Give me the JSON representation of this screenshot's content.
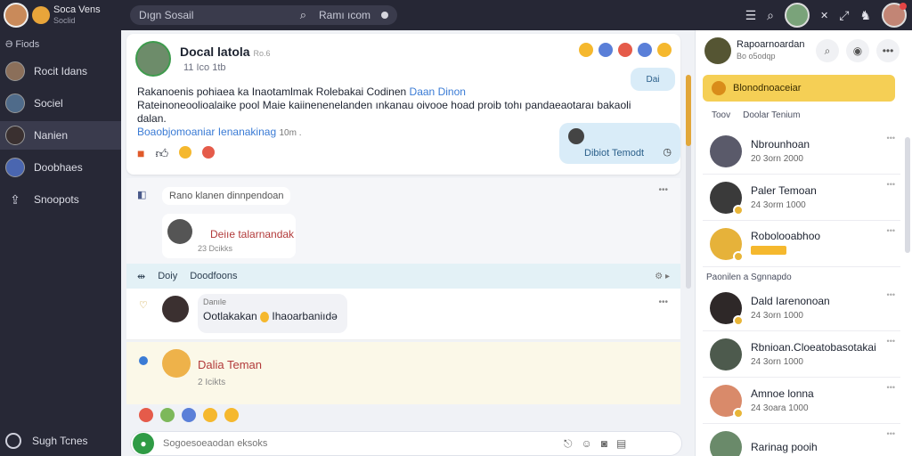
{
  "brand": {
    "name": "Soca Vens",
    "sub": "Soclid"
  },
  "search": {
    "placeholder": "Dıgn Sosail",
    "scope": "Ramı ıcom"
  },
  "sidebar": {
    "header": "Ə Fiods",
    "items": [
      {
        "label": "Rocit Idans"
      },
      {
        "label": "Sociel"
      },
      {
        "label": "Nanien"
      },
      {
        "label": "Doobhaes"
      },
      {
        "label": "Snoopots"
      }
    ],
    "bottom": "Sugh Tcnes"
  },
  "post": {
    "author": "Docal latola",
    "author_suffix": "Ro.6",
    "meta": "11 Ico 1tb",
    "body_line1": "Rakanoenis pohiaea ka Inaotamlmak Rolebakai Codinen",
    "body_link1": "Daan Dinon",
    "body_line2": "Rateinoneoolioalaike pool Maie kaiinenenelanden ınkanau oivooe hoad proib tohı pandaeaotaraı",
    "body_line2_tail": "bakaoli dalan.",
    "body_line3_link": "Boaobjomoaniar Ienanakinag",
    "body_line3_meta": "10m .",
    "bubble_top": "Dai",
    "bubble_name": "Dibiot Temodt"
  },
  "comments": {
    "header": "Rano klanen dinnpendoan",
    "first_name": "Deiıe talarnandak",
    "first_meta": "23 Dcikks"
  },
  "tabs": {
    "a": "Doiy",
    "b": "Doodfoons"
  },
  "reply1": {
    "author": "Danıle",
    "text": "Ootlakakan",
    "tail": "Ihaoarbaniıdə"
  },
  "reply2": {
    "name": "Dalia Teman",
    "meta": "2 Icikts"
  },
  "composer": {
    "placeholder": "Sogoesoeaodan eksoks"
  },
  "right": {
    "head_title": "Rapoarnoardan",
    "head_sub": "Bo o5odqp",
    "banner": "Blonodnoaceiar",
    "subhead_a": "Toov",
    "subhead_b": "Doolar Tenium",
    "contacts": [
      {
        "name": "Nbrounhoan",
        "meta": "20 3orn 2000"
      },
      {
        "name": "Paler Temoan",
        "meta": "24 3orm 1000"
      },
      {
        "name": "Robolooabhoo",
        "meta": ""
      },
      {
        "name": "Dald Iarenonoan",
        "meta": "24 3orn 1000"
      },
      {
        "name": "Rbnioan.Cloeatobasotakai",
        "meta": "24 3orn 1000"
      },
      {
        "name": "Amnoe lonna",
        "meta": "24 3oara 1000"
      },
      {
        "name": "Rarinag pooih",
        "meta": ""
      }
    ],
    "divider": "Paonilen a Sgnnapdo"
  }
}
